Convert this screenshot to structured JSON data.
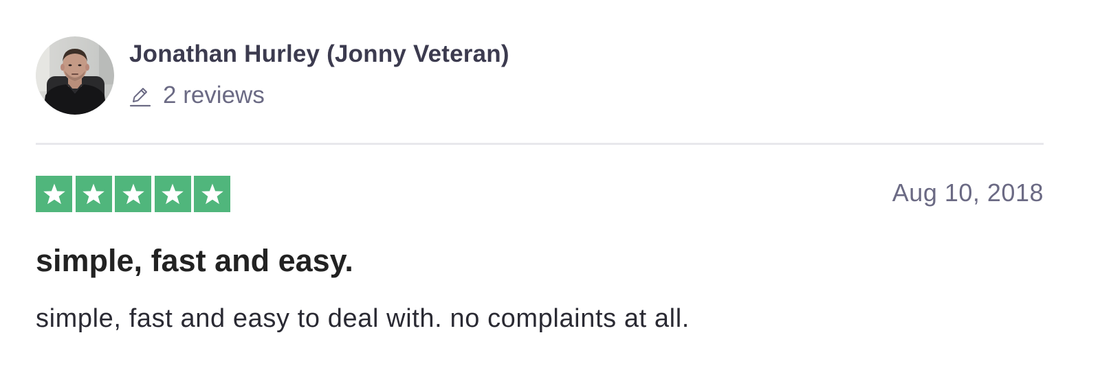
{
  "review": {
    "consumer": {
      "name": "Jonathan Hurley (Jonny Veteran)",
      "avatar_icon": "user-photo",
      "reviews_icon": "pencil-icon",
      "reviews_count": "2 reviews"
    },
    "rating": {
      "stars": 5,
      "max_stars": 5,
      "star_color": "#50b67c"
    },
    "date": "Aug 10, 2018",
    "title": "simple, fast and easy.",
    "body": "simple, fast and easy to deal with. no complaints at all."
  }
}
